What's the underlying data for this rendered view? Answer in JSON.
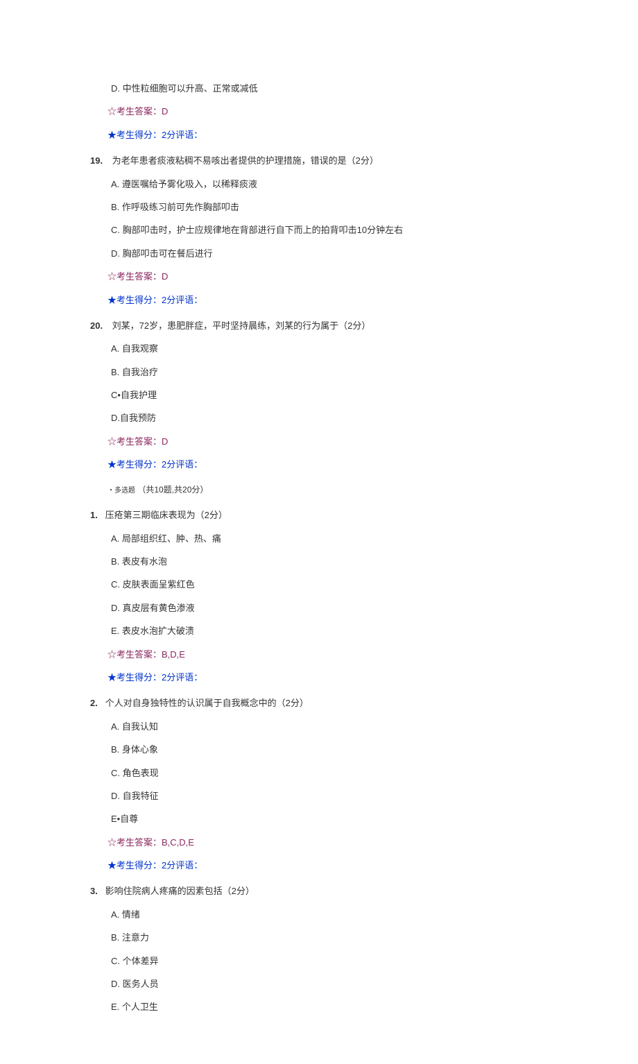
{
  "partial_question_top": {
    "option_D": "D.   中性粒细胞可以升高、正常或减低",
    "answer": "☆考生答案：D",
    "score": "★考生得分：2分评语："
  },
  "questions_single": [
    {
      "number": "19.",
      "stem": "为老年患者痰液粘稠不易咳出者提供的护理措施，错误的是（2分）",
      "options": [
        "A.   遵医嘱给予雾化吸入，以稀释痰液",
        "B.   作呼吸练习前可先作胸部叩击",
        "C.   胸部叩击时，护士应规律地在背部进行自下而上的拍背叩击10分钟左右",
        "D.   胸部叩击可在餐后进行"
      ],
      "answer": "☆考生答案：D",
      "score": "★考生得分：2分评语："
    },
    {
      "number": "20.",
      "stem": "刘某，72岁，患肥胖症，平时坚持晨练，刘某的行为属于（2分）",
      "options": [
        "A.   自我观察",
        "B.   自我治疗",
        "C•自我护理",
        "D.自我预防"
      ],
      "answer": "☆考生答案：D",
      "score": "★考生得分：2分评语："
    }
  ],
  "section": {
    "type": "・多选题",
    "label": "（共10题,共20分）"
  },
  "questions_multi": [
    {
      "number": "1.",
      "stem": "压疮第三期临床表现为（2分）",
      "options": [
        "A.   局部组织红、肿、热、痛",
        "B.   表皮有水泡",
        "C.   皮肤表面呈紫红色",
        "D.   真皮层有黄色渗液",
        "E.   表皮水泡扩大破溃"
      ],
      "answer": "☆考生答案：B,D,E",
      "score": "★考生得分：2分评语："
    },
    {
      "number": "2.",
      "stem": "个人对自身独特性的认识属于自我概念中的（2分）",
      "options": [
        "A.   自我认知",
        "B.   身体心象",
        "C.   角色表现",
        "D.   自我特征",
        "E•自尊"
      ],
      "answer": "☆考生答案：B,C,D,E",
      "score": "★考生得分：2分评语："
    },
    {
      "number": "3.",
      "stem": "影响住院病人疼痛的因素包括（2分）",
      "options": [
        "A.   情绪",
        "B.   注意力",
        "C.   个体差异",
        "D.   医务人员",
        "E.   个人卫生"
      ],
      "answer": "",
      "score": ""
    }
  ]
}
